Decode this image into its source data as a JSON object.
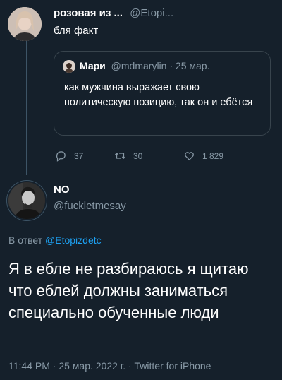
{
  "tweet1": {
    "name": "розовая из ...",
    "handle": "@Etopi...",
    "text": "бля факт"
  },
  "quote": {
    "name": "Мари",
    "handle": "@mdmarylin",
    "dot": "·",
    "date": "25 мар.",
    "text": "как мужчина выражает свою политическую позицию, так он и ебётся"
  },
  "actions": {
    "replies": "37",
    "retweets": "30",
    "likes": "1 829"
  },
  "tweet2": {
    "name": "NO",
    "handle": "@fuckletmesay",
    "reply_prefix": "В ответ",
    "reply_handle": "@Etopizdetc",
    "text": "Я в ебле не разбираюсь я щитаю что еблей должны заниматься специально обученные люди",
    "meta": "11:44 PM · 25 мар. 2022 г. · Twitter for iPhone"
  },
  "colors": {
    "background": "#15202b",
    "text": "#ffffff",
    "muted": "#8899a6",
    "link": "#1da1f2",
    "border": "#38444d"
  }
}
